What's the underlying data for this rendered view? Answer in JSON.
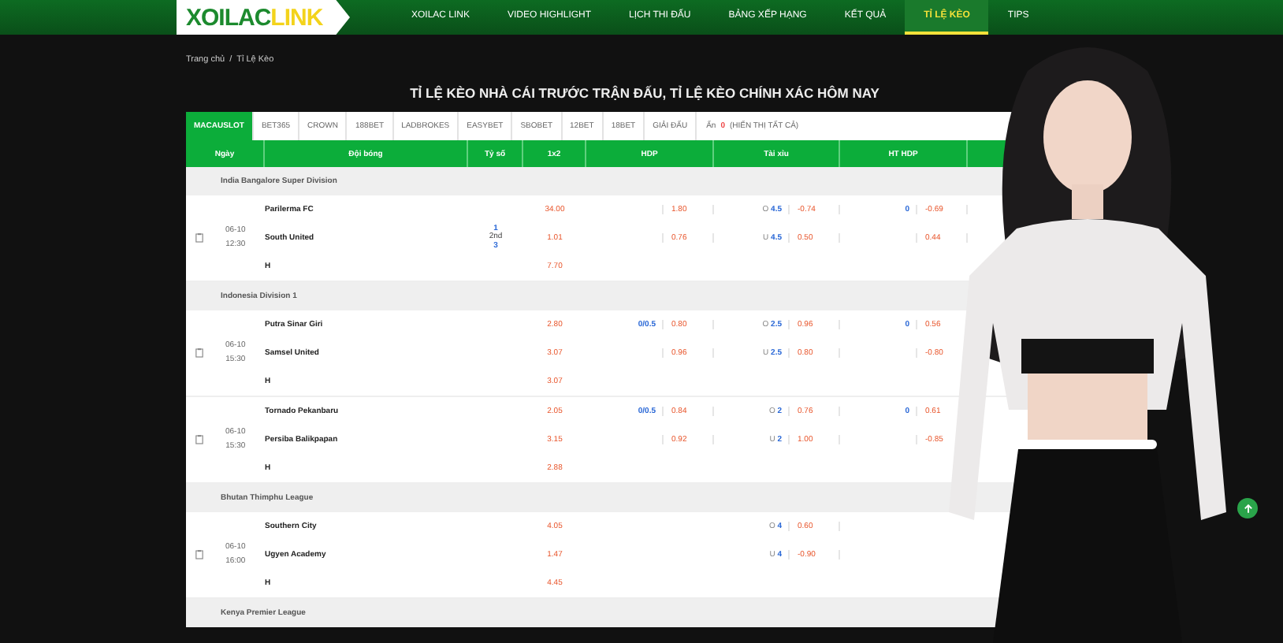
{
  "logo": {
    "parts": [
      "XOILAC",
      "LINK"
    ]
  },
  "nav": [
    {
      "label": "XOILAC LINK",
      "selected": false
    },
    {
      "label": "VIDEO HIGHLIGHT",
      "selected": false
    },
    {
      "label": "LỊCH THI ĐẤU",
      "selected": false
    },
    {
      "label": "BẢNG XẾP HẠNG",
      "selected": false
    },
    {
      "label": "KẾT QUẢ",
      "selected": false
    },
    {
      "label": "TỈ LỆ KÈO",
      "selected": true
    },
    {
      "label": "TIPS",
      "selected": false
    }
  ],
  "breadcrumb": [
    "Trang chủ",
    "/",
    "Tỉ Lệ Kèo"
  ],
  "title": "TỈ LỆ KÈO NHÀ CÁI TRƯỚC TRẬN ĐẤU, TỈ LỆ KÈO CHÍNH XÁC HÔM NAY",
  "tabs": [
    {
      "label": "MACAUSLOT",
      "selected": true
    },
    {
      "label": "BET365",
      "selected": false
    },
    {
      "label": "CROWN",
      "selected": false
    },
    {
      "label": "188BET",
      "selected": false
    },
    {
      "label": "LADBROKES",
      "selected": false
    },
    {
      "label": "EASYBET",
      "selected": false
    },
    {
      "label": "SBOBET",
      "selected": false
    },
    {
      "label": "12BET",
      "selected": false
    },
    {
      "label": "18BET",
      "selected": false
    },
    {
      "label": "GIẢI ĐẤU",
      "selected": false
    }
  ],
  "hidden_filter": {
    "label": "Ẩn",
    "count": "0",
    "link": "(HIỂN THỊ TẤT CẢ)"
  },
  "table": {
    "columns": [
      "Ngày",
      "Đội bóng",
      "Tỷ số",
      "1x2",
      "HDP",
      "Tài xỉu",
      "HT HDP"
    ],
    "leagues": [
      {
        "name": "India Bangalore Super Division",
        "matches": [
          {
            "date": "06-10",
            "time": "12:30",
            "score": [
              "1",
              "2nd",
              "3"
            ],
            "teams": [
              "Parilerma FC",
              "South United",
              "H"
            ],
            "odds_1x2": [
              "34.00",
              "1.01",
              "7.70"
            ],
            "hdp": [
              {
                "odds": "1.80"
              },
              {
                "odds": "0.76"
              }
            ],
            "tai_xiu": [
              {
                "side": "O",
                "line": "4.5",
                "odds": "-0.74"
              },
              {
                "side": "U",
                "line": "4.5",
                "odds": "0.50"
              }
            ],
            "ht_hdp": [
              {
                "line": "0",
                "odds": "-0.69"
              },
              {
                "odds": "0.44"
              }
            ]
          }
        ]
      },
      {
        "name": "Indonesia Division 1",
        "matches": [
          {
            "date": "06-10",
            "time": "15:30",
            "teams": [
              "Putra Sinar Giri",
              "Samsel United",
              "H"
            ],
            "odds_1x2": [
              "2.80",
              "3.07",
              "3.07"
            ],
            "hdp": [
              {
                "line": "0/0.5",
                "odds": "0.80"
              },
              {
                "odds": "0.96"
              }
            ],
            "tai_xiu": [
              {
                "side": "O",
                "line": "2.5",
                "odds": "0.96"
              },
              {
                "side": "U",
                "line": "2.5",
                "odds": "0.80"
              }
            ],
            "ht_hdp": [
              {
                "line": "0",
                "odds": "0.56"
              },
              {
                "odds": "-0.80"
              }
            ]
          },
          {
            "date": "06-10",
            "time": "15:30",
            "teams": [
              "Tornado Pekanbaru",
              "Persiba Balikpapan",
              "H"
            ],
            "odds_1x2": [
              "2.05",
              "3.15",
              "2.88"
            ],
            "hdp": [
              {
                "line": "0/0.5",
                "odds": "0.84"
              },
              {
                "odds": "0.92"
              }
            ],
            "tai_xiu": [
              {
                "side": "O",
                "line": "2",
                "odds": "0.76"
              },
              {
                "side": "U",
                "line": "2",
                "odds": "1.00"
              }
            ],
            "ht_hdp": [
              {
                "line": "0",
                "odds": "0.61"
              },
              {
                "odds": "-0.85"
              }
            ]
          }
        ]
      },
      {
        "name": "Bhutan Thimphu League",
        "matches": [
          {
            "date": "06-10",
            "time": "16:00",
            "teams": [
              "Southern City",
              "Ugyen Academy",
              "H"
            ],
            "odds_1x2": [
              "4.05",
              "1.47",
              "4.45"
            ],
            "tai_xiu": [
              {
                "side": "O",
                "line": "4",
                "odds": "0.60"
              },
              {
                "side": "U",
                "line": "4",
                "odds": "-0.90"
              }
            ]
          }
        ]
      },
      {
        "name": "Kenya Premier League"
      }
    ]
  }
}
